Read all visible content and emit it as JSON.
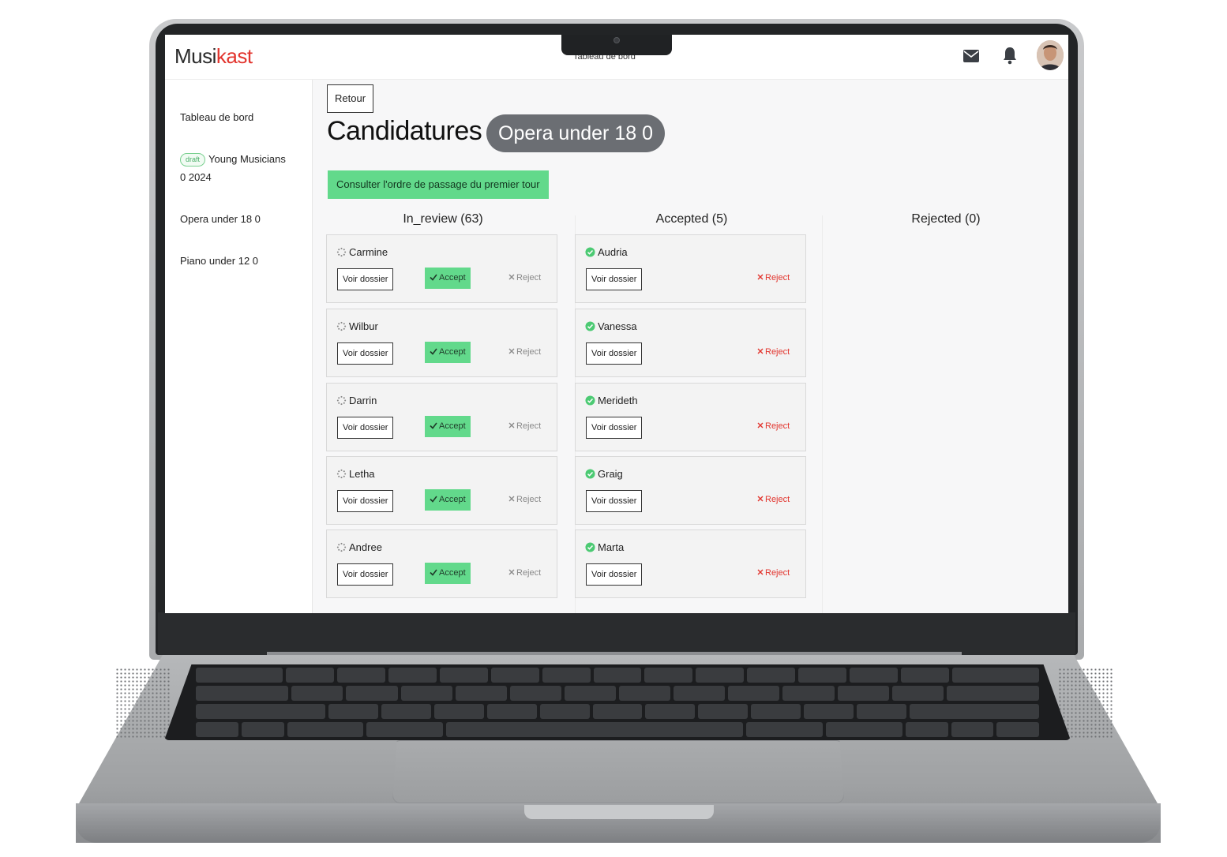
{
  "header": {
    "logo_part1": "Musi",
    "logo_part2": "kast",
    "page_label": "Tableau de bord"
  },
  "sidebar": {
    "items": [
      {
        "label": "Tableau de bord"
      },
      {
        "badge": "draft",
        "label_line1": "Young Musicians",
        "label_line2": "0 2024"
      },
      {
        "label": "Opera under 18 0"
      },
      {
        "label": "Piano under 12 0"
      }
    ]
  },
  "main": {
    "back_label": "Retour",
    "title": "Candidatures",
    "competition": "Opera under 18 0",
    "order_button": "Consulter l'ordre de passage du premier tour"
  },
  "columns": {
    "in_review": {
      "title": "In_review (63)",
      "cards": [
        {
          "name": "Carmine",
          "voir": "Voir dossier",
          "accept": "Accept",
          "reject": "Reject"
        },
        {
          "name": "Wilbur",
          "voir": "Voir dossier",
          "accept": "Accept",
          "reject": "Reject"
        },
        {
          "name": "Darrin",
          "voir": "Voir dossier",
          "accept": "Accept",
          "reject": "Reject"
        },
        {
          "name": "Letha",
          "voir": "Voir dossier",
          "accept": "Accept",
          "reject": "Reject"
        },
        {
          "name": "Andree",
          "voir": "Voir dossier",
          "accept": "Accept",
          "reject": "Reject"
        }
      ]
    },
    "accepted": {
      "title": "Accepted (5)",
      "cards": [
        {
          "name": "Audria",
          "voir": "Voir dossier",
          "reject": "Reject"
        },
        {
          "name": "Vanessa",
          "voir": "Voir dossier",
          "reject": "Reject"
        },
        {
          "name": "Merideth",
          "voir": "Voir dossier",
          "reject": "Reject"
        },
        {
          "name": "Graig",
          "voir": "Voir dossier",
          "reject": "Reject"
        },
        {
          "name": "Marta",
          "voir": "Voir dossier",
          "reject": "Reject"
        }
      ]
    },
    "rejected": {
      "title": "Rejected (0)"
    }
  },
  "colors": {
    "brand_red": "#e2342d",
    "accept_green": "#62d98b",
    "pill_grey": "#6b6e73"
  },
  "icons": {
    "mail": "mail-icon",
    "bell": "bell-icon",
    "pending": "spinner-icon",
    "accepted": "check-circle-icon",
    "check": "check-icon",
    "cross": "x-icon"
  }
}
